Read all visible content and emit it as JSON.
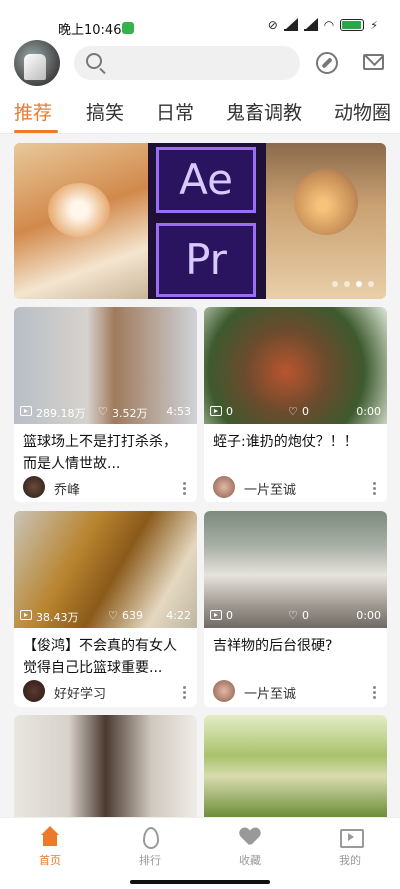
{
  "status": {
    "time": "晚上10:46",
    "wifi": "wifi-icon",
    "battery": "100"
  },
  "search": {
    "placeholder": ""
  },
  "tabs": [
    {
      "label": "推荐",
      "active": true
    },
    {
      "label": "搞笑"
    },
    {
      "label": "日常"
    },
    {
      "label": "鬼畜调教"
    },
    {
      "label": "动物圈"
    }
  ],
  "banner": {
    "ae": "Ae",
    "pr": "Pr",
    "dots": 4,
    "active_dot": 2
  },
  "cards": [
    {
      "views": "289.18万",
      "likes": "3.52万",
      "duration": "4:53",
      "title": "篮球场上不是打打杀杀，而是人情世故...",
      "author": "乔峰"
    },
    {
      "views": "0",
      "likes": "0",
      "duration": "0:00",
      "title": "蛭子:谁扔的炮仗？！！",
      "author": "一片至诚"
    },
    {
      "views": "38.43万",
      "likes": "639",
      "duration": "4:22",
      "title": "【俊鸿】不会真的有女人觉得自己比篮球重要...",
      "author": "好好学习"
    },
    {
      "views": "0",
      "likes": "0",
      "duration": "0:00",
      "title": "吉祥物的后台很硬?",
      "author": "一片至诚"
    }
  ],
  "nav": [
    {
      "label": "首页",
      "icon": "home-icon",
      "active": true
    },
    {
      "label": "排行",
      "icon": "fire-icon"
    },
    {
      "label": "收藏",
      "icon": "heart-icon"
    },
    {
      "label": "我的",
      "icon": "tv-icon"
    }
  ],
  "colors": {
    "accent": "#ec7a2b"
  }
}
